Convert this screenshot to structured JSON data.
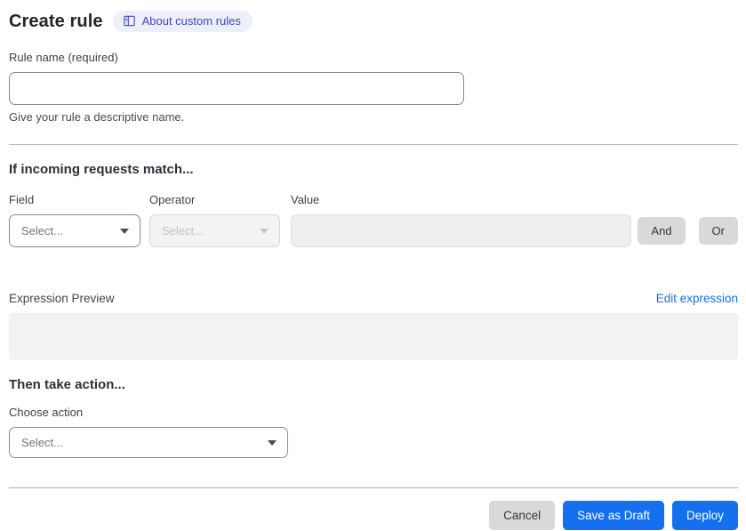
{
  "page": {
    "title": "Create rule",
    "about_badge": {
      "label": "About custom rules",
      "icon": "book-icon"
    }
  },
  "rule_name": {
    "label": "Rule name (required)",
    "value": "",
    "placeholder": "",
    "helper": "Give your rule a descriptive name."
  },
  "match_section": {
    "heading": "If incoming requests match...",
    "field": {
      "label": "Field",
      "selected": "Select...",
      "enabled": true
    },
    "operator": {
      "label": "Operator",
      "selected": "Select...",
      "enabled": false
    },
    "value": {
      "label": "Value",
      "value": "",
      "enabled": false
    },
    "and_button": "And",
    "or_button": "Or",
    "expression_preview_label": "Expression Preview",
    "edit_expression_link": "Edit expression",
    "expression_value": ""
  },
  "action_section": {
    "heading": "Then take action...",
    "choose_label": "Choose action",
    "selected": "Select..."
  },
  "footer": {
    "cancel_button": "Cancel",
    "save_draft_button": "Save as Draft",
    "deploy_button": "Deploy"
  },
  "colors": {
    "badge_bg": "#edeffb",
    "badge_text": "#3b49c4",
    "link_blue": "#1570e8",
    "primary_button_blue": "#1570ef",
    "gray_button": "#d9d9d9",
    "disabled_bg": "#f3f3f3",
    "preview_box_bg": "#f2f2f2"
  }
}
